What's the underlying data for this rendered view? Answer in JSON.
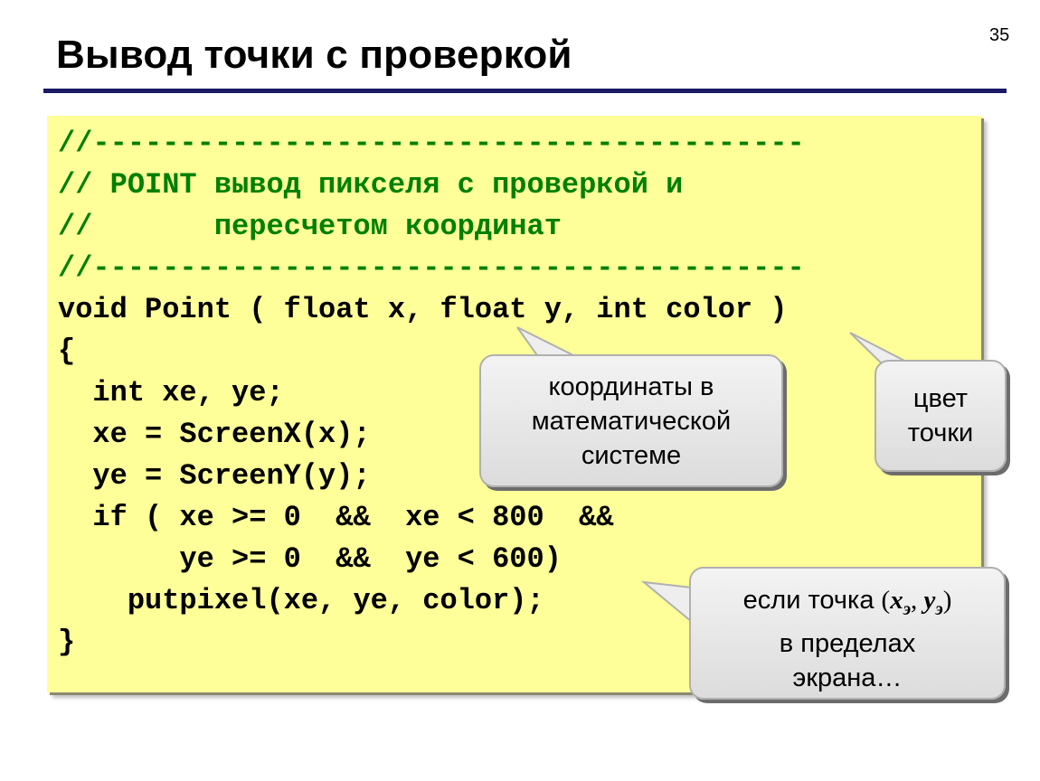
{
  "slide_number": "35",
  "title": "Вывод точки с проверкой",
  "code_lines": [
    "//-----------------------------------------",
    "// POINT вывод пикселя с проверкой и",
    "//       пересчетом координат",
    "//-----------------------------------------",
    "void Point ( float x, float y, int color )",
    "{",
    "  int xe, ye;",
    "  xe = ScreenX(x);",
    "  ye = ScreenY(y);",
    "  if ( xe >= 0  &&  xe < 800  &&",
    "       ye >= 0  &&  ye < 600)",
    "    putpixel(xe, ye, color);",
    "}"
  ],
  "callouts": {
    "coords": [
      "координаты в",
      "математической",
      "системе"
    ],
    "color": [
      "цвет",
      "точки"
    ],
    "bounds": {
      "line1_prefix": "если точка ",
      "open_paren": "(",
      "xe": "x",
      "xe_sub": "э",
      "comma": ", ",
      "ye": "y",
      "ye_sub": "э",
      "close_paren": ")",
      "line2": "в пределах",
      "line3": "экрана…"
    }
  },
  "colors": {
    "code_background": "#ffff99",
    "comment_text": "#008000",
    "title_rule": "#1a1a66",
    "callout_fill": "#e6e6e6"
  }
}
